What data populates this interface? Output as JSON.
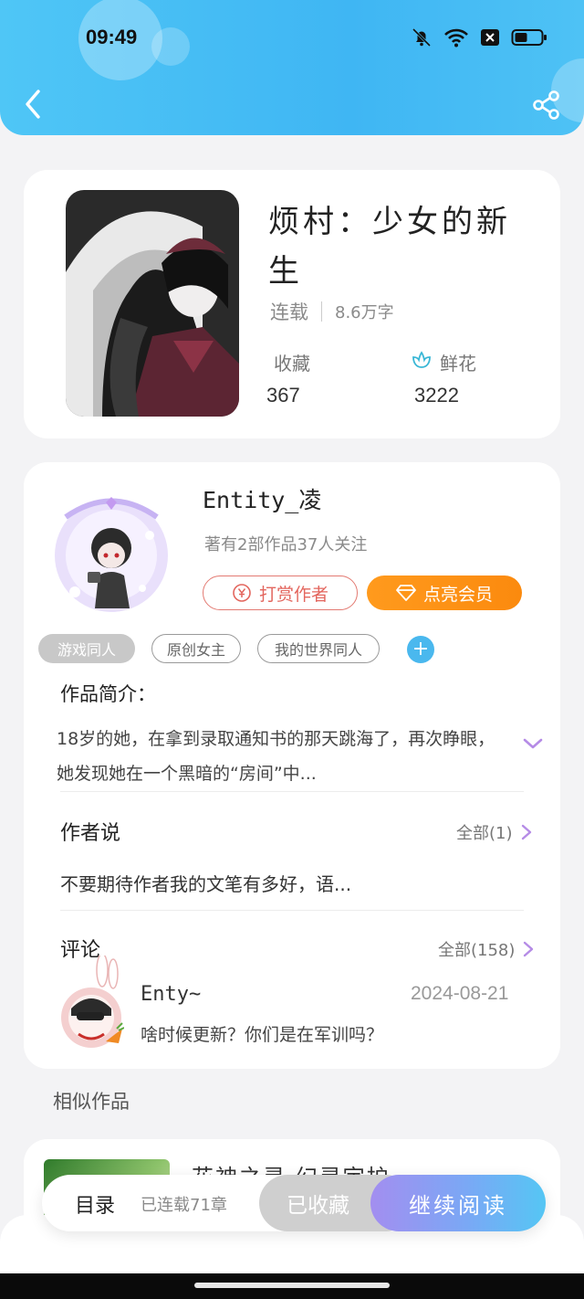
{
  "status_bar": {
    "time": "09:49",
    "icons": [
      "bell-muted-icon",
      "wifi-icon",
      "close-box-icon",
      "battery-icon"
    ]
  },
  "header": {
    "back_icon": "chevron-left-icon",
    "share_icon": "share-icon"
  },
  "book": {
    "title": "烦村：少女的新生",
    "status": "连载",
    "word_count": "8.6万字",
    "favorites_label": "收藏",
    "favorites_count": "367",
    "flowers_label": "鲜花",
    "flowers_count": "3222"
  },
  "author": {
    "name": "Entity_凌",
    "stats": "著有2部作品37人关注",
    "tip_label": "打赏作者",
    "vip_label": "点亮会员",
    "tags": [
      "游戏同人",
      "原创女主",
      "我的世界同人"
    ],
    "add_tag": "+"
  },
  "intro": {
    "heading": "作品简介：",
    "text": "18岁的她，在拿到录取通知书的那天跳海了，再次睁眼，她发现她在一个黑暗的“房间”中..."
  },
  "author_says": {
    "heading": "作者说",
    "more_label": "全部(1)",
    "text": "不要期待作者我的文笔有多好，语..."
  },
  "comments": {
    "heading": "评论",
    "more_label": "全部(158)",
    "items": [
      {
        "user": "Enty~",
        "date": "2024-08-21",
        "text": "啥时候更新？你们是在军训吗？"
      }
    ]
  },
  "similar": {
    "heading": "相似作品",
    "items": [
      {
        "title": "花神之灵 幻灵宇护"
      }
    ]
  },
  "bottom_bar": {
    "toc_label": "目录",
    "toc_status": "已连载71章",
    "fav_label": "已收藏",
    "read_label": "继续阅读"
  },
  "colors": {
    "header": "#3fb6f3",
    "tip": "#e3665e",
    "vip": "#fb8a0e",
    "read_start": "#a38ef0",
    "read_end": "#55c6f4",
    "accent_purple": "#b58be6"
  }
}
